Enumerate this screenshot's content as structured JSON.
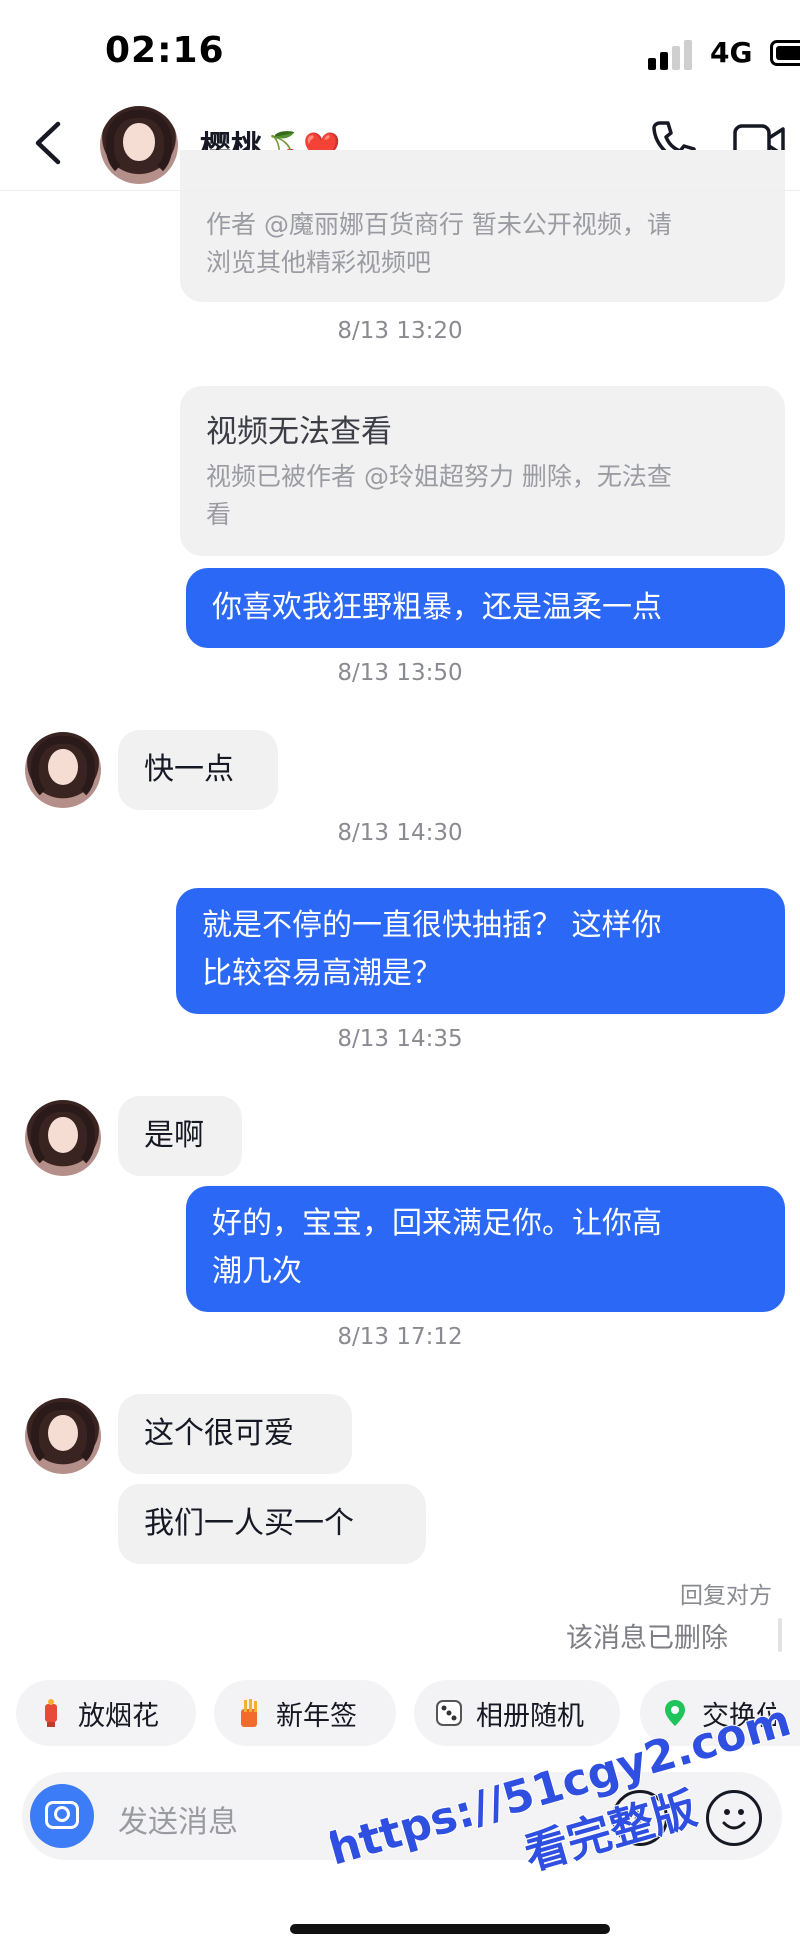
{
  "status_bar": {
    "time": "02:16",
    "network": "4G"
  },
  "header": {
    "contact_name": "樱桃",
    "emoji": "🍒❤️"
  },
  "messages": {
    "notice1_body_line1": "作者 @魔丽娜百货商行 暂未公开视频，请",
    "notice1_body_line2": "浏览其他精彩视频吧",
    "ts1": "8/13 13:20",
    "notice2_title": "视频无法查看",
    "notice2_body_line1": "视频已被作者 @玲姐超努力 删除，无法查",
    "notice2_body_line2": "看",
    "out1": "你喜欢我狂野粗暴，还是温柔一点",
    "ts2": "8/13 13:50",
    "in1": "快一点",
    "ts3": "8/13 14:30",
    "out2_line1": "就是不停的一直很快抽插？ 这样你",
    "out2_line2": "比较容易高潮是？",
    "ts4": "8/13 14:35",
    "in2": "是啊",
    "out3_line1": "好的，宝宝，回来满足你。让你高",
    "out3_line2": "潮几次",
    "ts5": "8/13 17:12",
    "in3": "这个很可爱",
    "in4": "我们一人买一个",
    "reply_hint": "回复对方",
    "deleted_note": "该消息已删除"
  },
  "quick_actions": [
    "放烟花",
    "新年签",
    "相册随机",
    "交换位置"
  ],
  "input": {
    "placeholder": "发送消息"
  },
  "watermark": {
    "line1": "https://51cgy2.com",
    "line2": "看完整版"
  },
  "colors": {
    "accent_blue": "#2c68f6",
    "bubble_gray": "#f1f1f2",
    "watermark": "#2f4fe0"
  }
}
